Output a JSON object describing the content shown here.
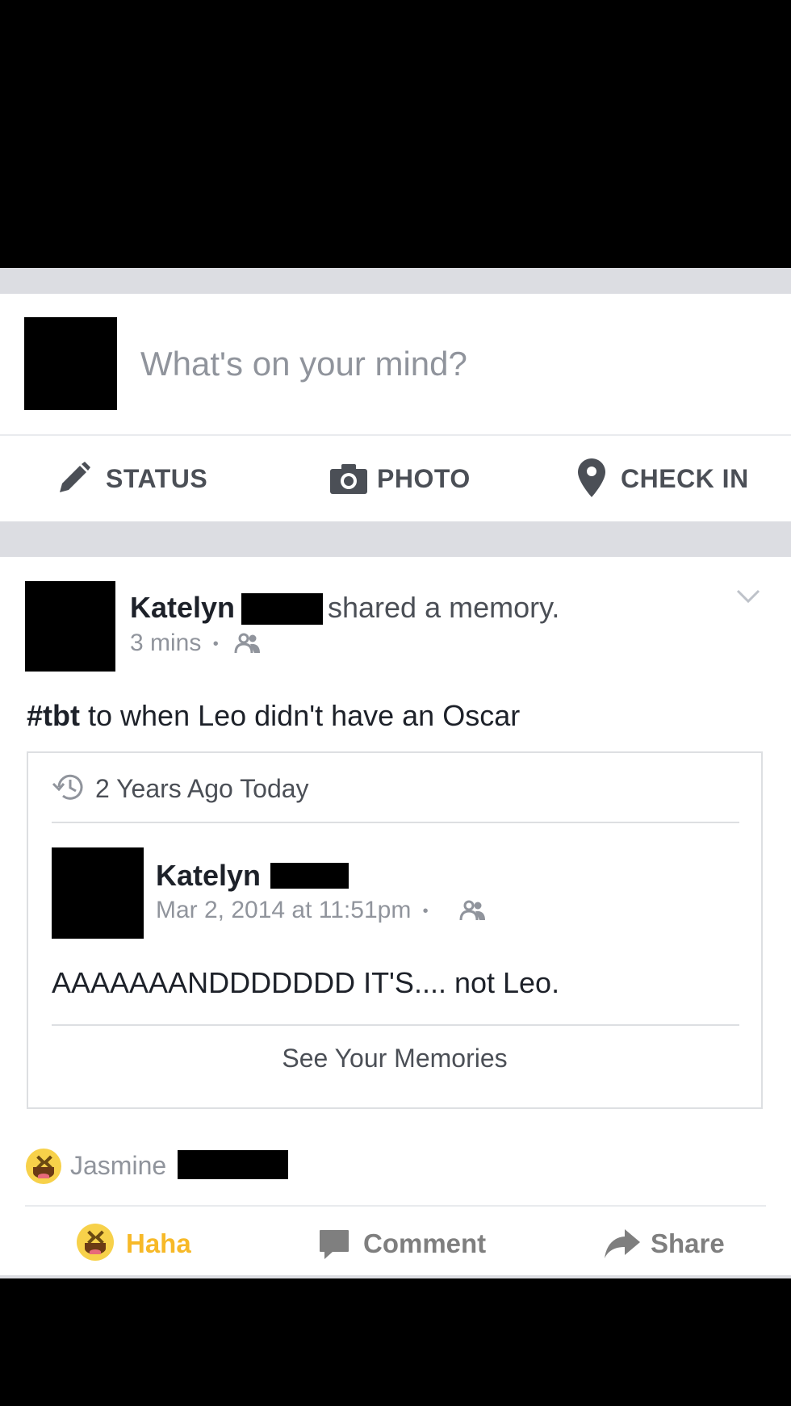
{
  "composer": {
    "prompt": "What's on your mind?",
    "actions": [
      {
        "label": "STATUS",
        "icon": "pencil-icon"
      },
      {
        "label": "PHOTO",
        "icon": "camera-icon"
      },
      {
        "label": "CHECK IN",
        "icon": "location-pin-icon"
      }
    ]
  },
  "post": {
    "author": "Katelyn",
    "action_text": "shared a memory.",
    "time": "3 mins",
    "separator": "•",
    "audience_icon": "friends-icon",
    "text_hashtag": "#tbt",
    "text_rest": " to when Leo didn't have an Oscar",
    "menu_icon": "chevron-down-icon",
    "memory": {
      "header": "2 Years Ago Today",
      "header_icon": "history-icon",
      "author": "Katelyn",
      "time": "Mar 2, 2014 at 11:51pm",
      "separator": "•",
      "text": "AAAAAAANDDDDDDD IT'S.... not Leo.",
      "see_link": "See Your Memories"
    },
    "reactions": {
      "reactor": "Jasmine",
      "icon": "haha-emoji-icon"
    },
    "footer": {
      "haha": "Haha",
      "comment": "Comment",
      "share": "Share"
    }
  },
  "colors": {
    "haha_accent": "#f7b928",
    "divider_gray": "#dcdde2",
    "text_dark": "#1d2129",
    "text_muted": "#90949c"
  }
}
